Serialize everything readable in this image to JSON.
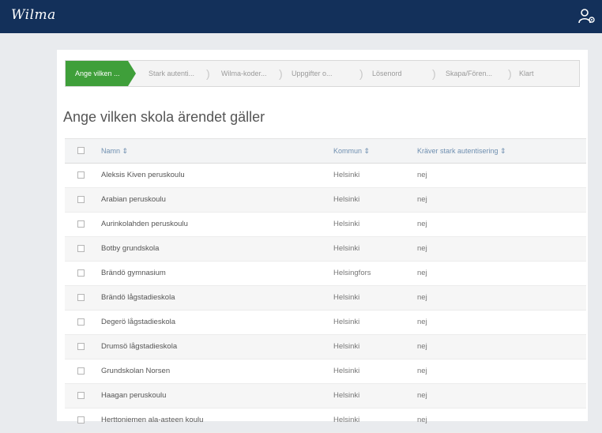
{
  "app": {
    "logo": "Wilma"
  },
  "wizard": {
    "steps": [
      {
        "label": "Ange vilken ..."
      },
      {
        "label": "Stark autenti..."
      },
      {
        "label": "Wilma-koder..."
      },
      {
        "label": "Uppgifter o..."
      },
      {
        "label": "Lösenord"
      },
      {
        "label": "Skapa/Fören..."
      },
      {
        "label": "Klart"
      }
    ],
    "separator": ")"
  },
  "page": {
    "title": "Ange vilken skola ärendet gäller"
  },
  "table": {
    "headers": {
      "name": "Namn ⇕",
      "kommun": "Kommun ⇕",
      "stark": "Kräver stark autentisering ⇕"
    },
    "rows": [
      {
        "name": "Aleksis Kiven peruskoulu",
        "kommun": "Helsinki",
        "stark": "nej"
      },
      {
        "name": "Arabian peruskoulu",
        "kommun": "Helsinki",
        "stark": "nej"
      },
      {
        "name": "Aurinkolahden peruskoulu",
        "kommun": "Helsinki",
        "stark": "nej"
      },
      {
        "name": "Botby grundskola",
        "kommun": "Helsinki",
        "stark": "nej"
      },
      {
        "name": "Brändö gymnasium",
        "kommun": "Helsingfors",
        "stark": "nej"
      },
      {
        "name": "Brändö lågstadieskola",
        "kommun": "Helsinki",
        "stark": "nej"
      },
      {
        "name": "Degerö lågstadieskola",
        "kommun": "Helsinki",
        "stark": "nej"
      },
      {
        "name": "Drumsö lågstadieskola",
        "kommun": "Helsinki",
        "stark": "nej"
      },
      {
        "name": "Grundskolan Norsen",
        "kommun": "Helsinki",
        "stark": "nej"
      },
      {
        "name": "Haagan peruskoulu",
        "kommun": "Helsinki",
        "stark": "nej"
      },
      {
        "name": "Herttoniemen ala-asteen koulu",
        "kommun": "Helsinki",
        "stark": "nej"
      }
    ]
  }
}
